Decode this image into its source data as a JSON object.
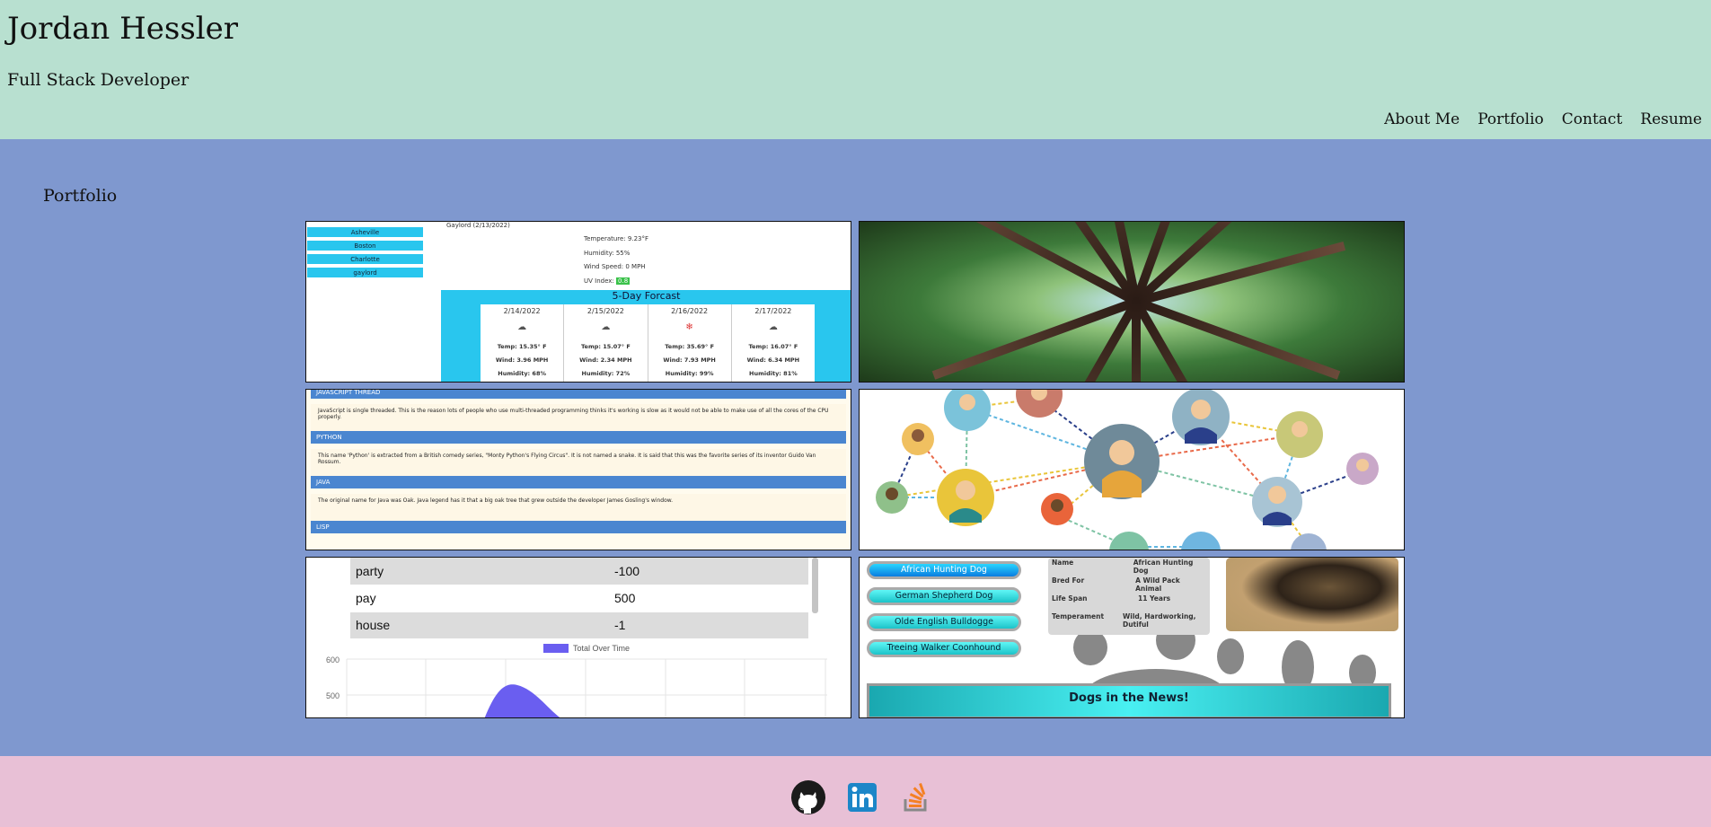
{
  "header": {
    "name": "Jordan Hessler",
    "subtitle": "Full Stack Developer",
    "nav": [
      "About Me",
      "Portfolio",
      "Contact",
      "Resume"
    ]
  },
  "main": {
    "section_title": "Portfolio"
  },
  "weather": {
    "cities": [
      "Asheville",
      "Boston",
      "Charlotte",
      "gaylord"
    ],
    "current_header": "Gaylord (2/13/2022)",
    "temperature": "Temperature: 9.23°F",
    "humidity": "Humidity: 55%",
    "wind": "Wind Speed: 0 MPH",
    "uv_label": "UV Index:",
    "uv_value": "0.8",
    "forecast_title": "5-Day Forcast",
    "days": [
      {
        "date": "2/14/2022",
        "temp": "Temp: 15.35° F",
        "wind": "Wind: 3.96 MPH",
        "humidity": "Humidity: 68%"
      },
      {
        "date": "2/15/2022",
        "temp": "Temp: 15.07° F",
        "wind": "Wind: 2.34 MPH",
        "humidity": "Humidity: 72%"
      },
      {
        "date": "2/16/2022",
        "temp": "Temp: 35.69° F",
        "wind": "Wind: 7.93 MPH",
        "humidity": "Humidity: 99%"
      },
      {
        "date": "2/17/2022",
        "temp": "Temp: 16.07° F",
        "wind": "Wind: 6.34 MPH",
        "humidity": "Humidity: 81%"
      }
    ]
  },
  "threads": {
    "items": [
      {
        "title": "JAVASCRIPT THREAD",
        "body": "JavaScript is single threaded. This is the reason lots of people who use multi-threaded programming thinks it's working is slow as it would not be able to make use of all the cores of the CPU properly."
      },
      {
        "title": "PYTHON",
        "body": "This name 'Python' is extracted from a British comedy series, \"Monty Python's Flying Circus\". It is not named a snake. It is said that this was the favorite series of its inventor Guido Van Rossum."
      },
      {
        "title": "JAVA",
        "body": "The original name for Java was Oak. Java legend has it that a big oak tree that grew outside the developer James Gosling's window."
      },
      {
        "title": "LISP",
        "body": ""
      }
    ]
  },
  "budget": {
    "rows": [
      {
        "name": "party",
        "value": "-100"
      },
      {
        "name": "pay",
        "value": "500"
      },
      {
        "name": "house",
        "value": "-1"
      }
    ],
    "legend": "Total Over Time",
    "y_ticks": [
      "600",
      "500"
    ],
    "series_color": "#6a5ef0"
  },
  "dogs": {
    "breeds": [
      "African Hunting Dog",
      "German Shepherd Dog",
      "Olde English Bulldogge",
      "Treeing Walker Coonhound"
    ],
    "info": [
      {
        "key": "Name",
        "value": "African Hunting Dog"
      },
      {
        "key": "Bred For",
        "value": "A Wild Pack Animal"
      },
      {
        "key": "Life Span",
        "value": "11 Years"
      },
      {
        "key": "Temperament",
        "value": "Wild, Hardworking, Dutiful"
      }
    ],
    "news_title": "Dogs in the News!"
  },
  "footer": {
    "icons": [
      "github-icon",
      "linkedin-icon",
      "stackoverflow-icon"
    ]
  },
  "colors": {
    "header_bg": "#b8e0d0",
    "main_bg": "#7f98cf",
    "footer_bg": "#e8c0d6"
  }
}
